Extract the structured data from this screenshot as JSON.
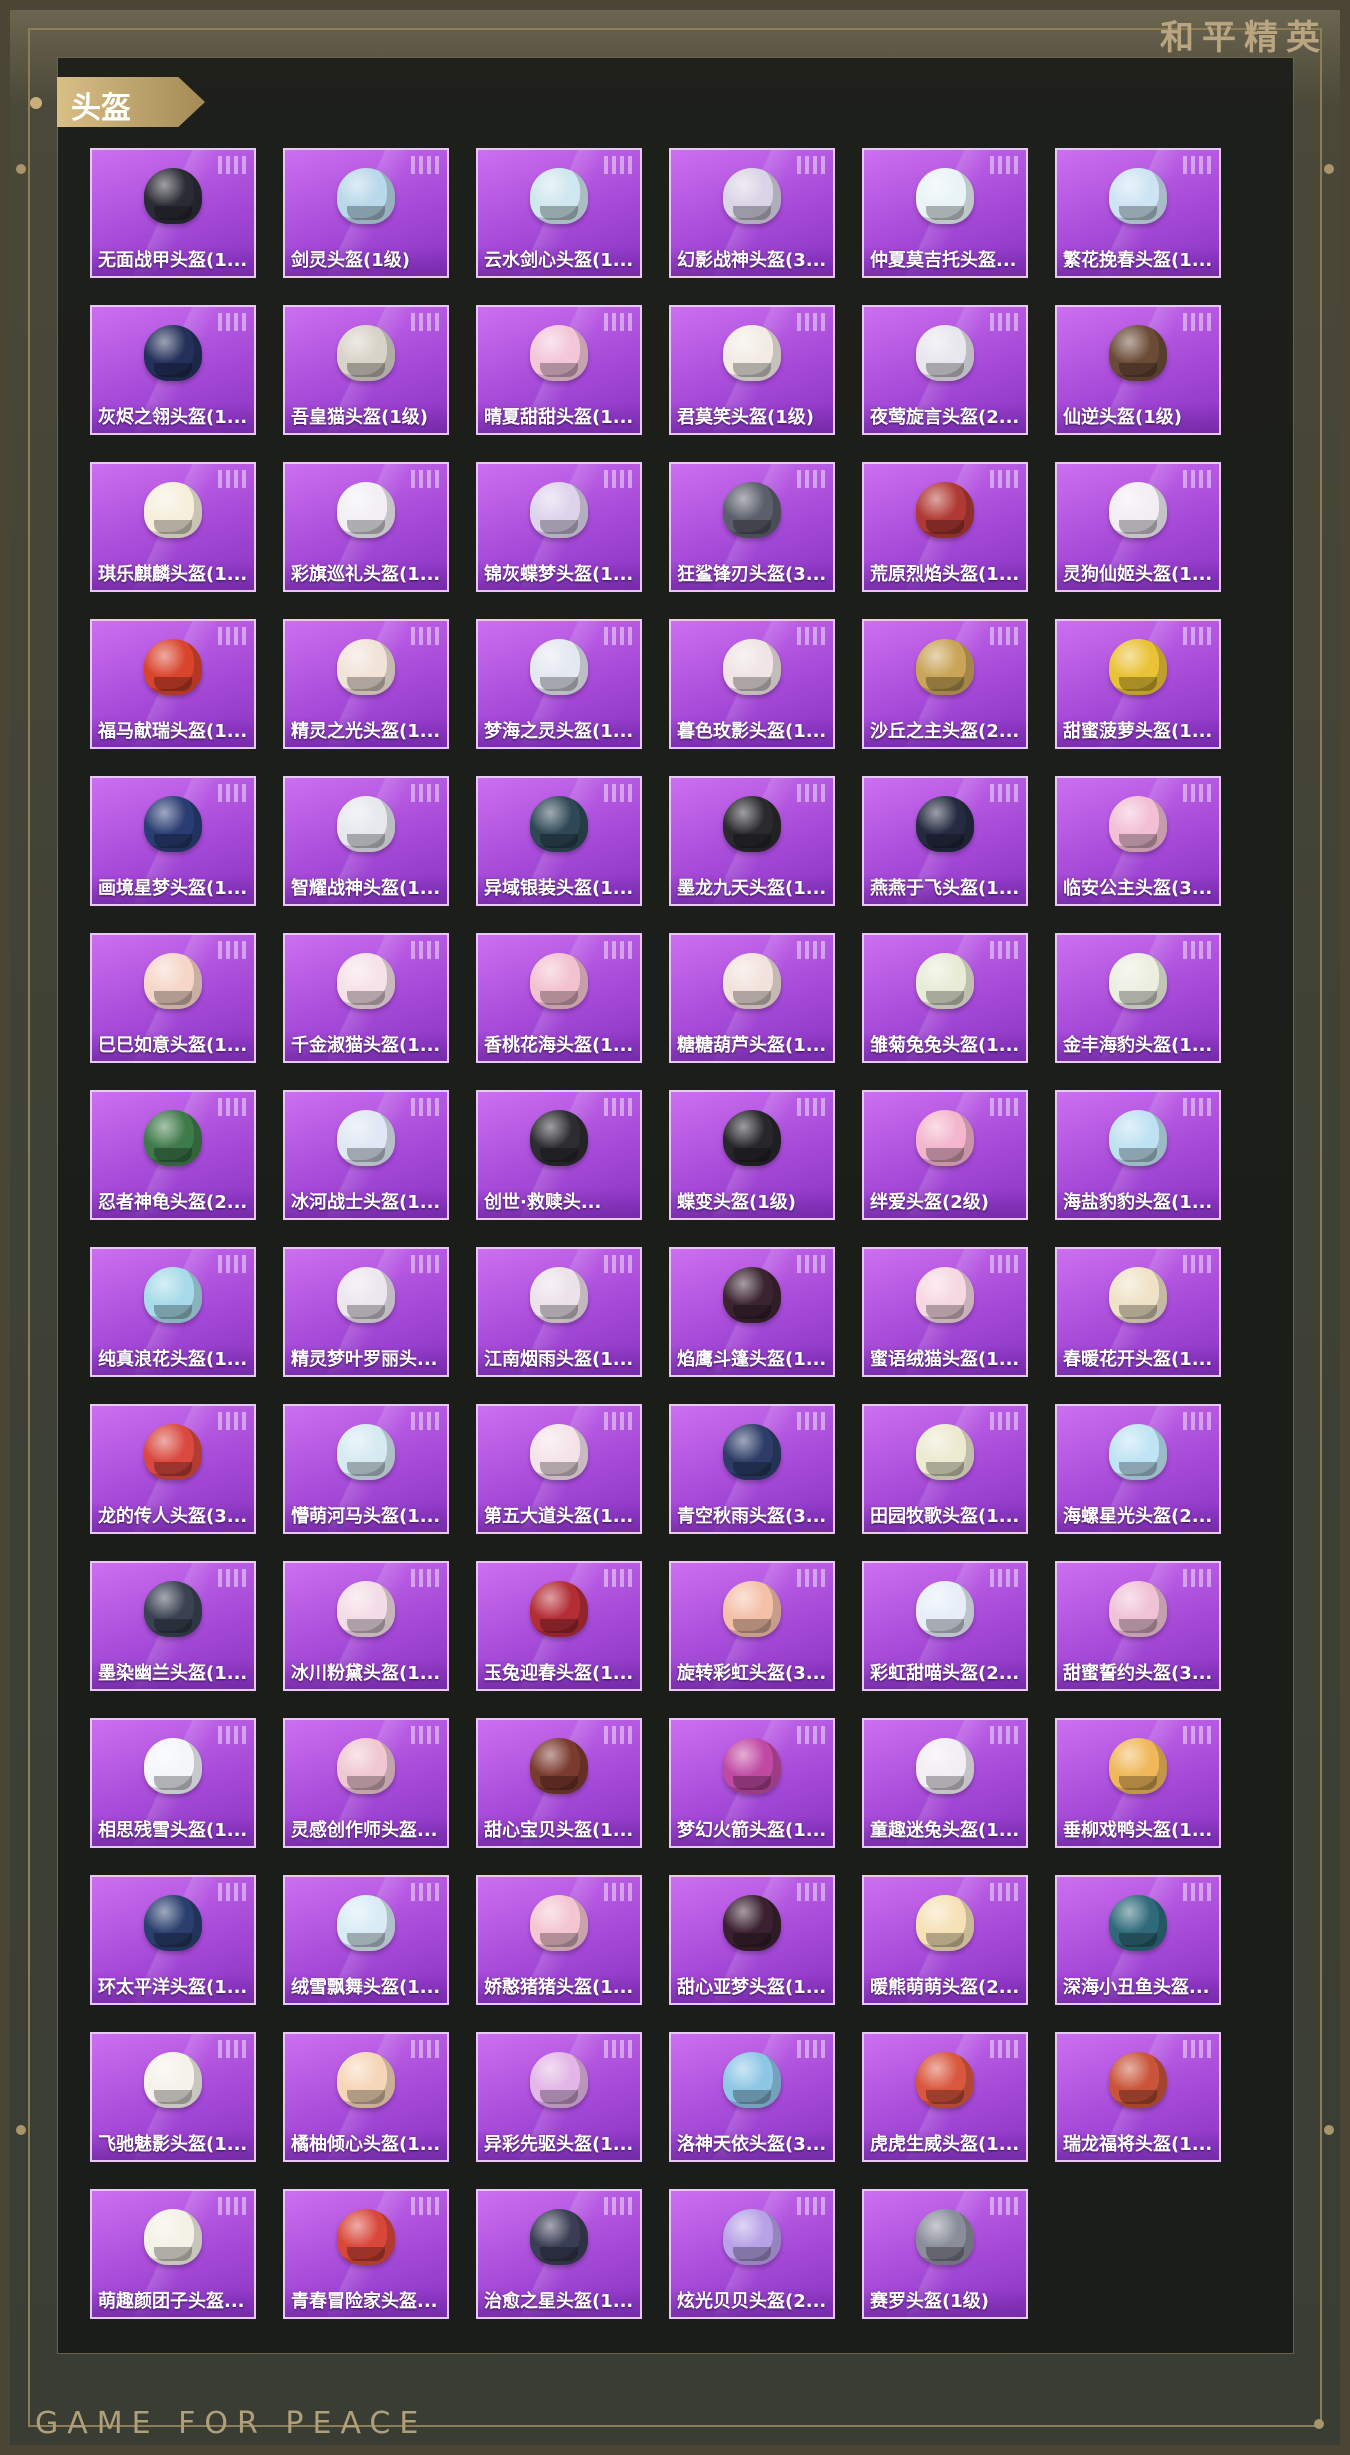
{
  "brand": "和平精英",
  "footer": "GAME FOR PEACE",
  "section_title": "头盔",
  "items": [
    {
      "label": "无面战甲头盔(1...",
      "color": "#2b2b35"
    },
    {
      "label": "剑灵头盔(1级)",
      "color": "#b9d8ea"
    },
    {
      "label": "云水剑心头盔(1...",
      "color": "#cfe7ee"
    },
    {
      "label": "幻影战神头盔(3...",
      "color": "#d9d4e6"
    },
    {
      "label": "仲夏莫吉托头盔...",
      "color": "#e9f4f6"
    },
    {
      "label": "繁花挽春头盔(1...",
      "color": "#cde4f3"
    },
    {
      "label": "灰烬之翎头盔(1...",
      "color": "#24305a"
    },
    {
      "label": "吾皇猫头盔(1级)",
      "color": "#d8d3c8"
    },
    {
      "label": "晴夏甜甜头盔(1...",
      "color": "#f3c6d8"
    },
    {
      "label": "君莫笑头盔(1级)",
      "color": "#f2ece4"
    },
    {
      "label": "夜莺旋言头盔(2...",
      "color": "#e8e6ee"
    },
    {
      "label": "仙逆头盔(1级)",
      "color": "#6b4b36"
    },
    {
      "label": "琪乐麒麟头盔(1...",
      "color": "#f6efdc"
    },
    {
      "label": "彩旗巡礼头盔(1...",
      "color": "#f2f0f4"
    },
    {
      "label": "锦灰蝶梦头盔(1...",
      "color": "#ddd4ec"
    },
    {
      "label": "狂鲨锋刃头盔(3...",
      "color": "#5b5f6b"
    },
    {
      "label": "荒原烈焰头盔(1...",
      "color": "#b03a33"
    },
    {
      "label": "灵狗仙姬头盔(1...",
      "color": "#f2eef4"
    },
    {
      "label": "福马献瑞头盔(1...",
      "color": "#d9442d"
    },
    {
      "label": "精灵之光头盔(1...",
      "color": "#f2e3d8"
    },
    {
      "label": "梦海之灵头盔(1...",
      "color": "#e4e8f0"
    },
    {
      "label": "暮色玫影头盔(1...",
      "color": "#f0e4e4"
    },
    {
      "label": "沙丘之主头盔(2...",
      "color": "#c9a557"
    },
    {
      "label": "甜蜜菠萝头盔(1...",
      "color": "#e9c235"
    },
    {
      "label": "画境星梦头盔(1...",
      "color": "#2a3d73"
    },
    {
      "label": "智耀战神头盔(1...",
      "color": "#e6e8ee"
    },
    {
      "label": "异域银装头盔(1...",
      "color": "#2e4855"
    },
    {
      "label": "墨龙九天头盔(1...",
      "color": "#2a2a2e"
    },
    {
      "label": "燕燕于飞头盔(1...",
      "color": "#242a40"
    },
    {
      "label": "临安公主头盔(3...",
      "color": "#f2bfd4"
    },
    {
      "label": "巳巳如意头盔(1...",
      "color": "#f6d6c8"
    },
    {
      "label": "千金淑猫头盔(1...",
      "color": "#f6e2e8"
    },
    {
      "label": "香桃花海头盔(1...",
      "color": "#f3c2d0"
    },
    {
      "label": "糖糖葫芦头盔(1...",
      "color": "#f2e2dc"
    },
    {
      "label": "雏菊兔兔头盔(1...",
      "color": "#e8ecd6"
    },
    {
      "label": "金丰海豹头盔(1...",
      "color": "#ecefe0"
    },
    {
      "label": "忍者神龟头盔(2...",
      "color": "#3f7a4a"
    },
    {
      "label": "冰河战士头盔(1...",
      "color": "#dfe8f4"
    },
    {
      "label": "创世·救赎头...",
      "color": "#2d2d31"
    },
    {
      "label": "蝶变头盔(1级)",
      "color": "#27272b"
    },
    {
      "label": "绊爱头盔(2级)",
      "color": "#f3b6cc"
    },
    {
      "label": "海盐豹豹头盔(1...",
      "color": "#bfe2f2"
    },
    {
      "label": "纯真浪花头盔(1...",
      "color": "#a7dbe9"
    },
    {
      "label": "精灵梦叶罗丽头...",
      "color": "#ece6ee"
    },
    {
      "label": "江南烟雨头盔(1...",
      "color": "#ece2ea"
    },
    {
      "label": "焰鹰斗篷头盔(1...",
      "color": "#3b2430"
    },
    {
      "label": "蜜语绒猫头盔(1...",
      "color": "#f6d8e2"
    },
    {
      "label": "春暖花开头盔(1...",
      "color": "#efe2c6"
    },
    {
      "label": "龙的传人头盔(3...",
      "color": "#d94940"
    },
    {
      "label": "懵萌河马头盔(1...",
      "color": "#d6eaf2"
    },
    {
      "label": "第五大道头盔(1...",
      "color": "#f4e4ea"
    },
    {
      "label": "青空秋雨头盔(3...",
      "color": "#2d3d68"
    },
    {
      "label": "田园牧歌头盔(1...",
      "color": "#ecead0"
    },
    {
      "label": "海螺星光头盔(2...",
      "color": "#bfe4f4"
    },
    {
      "label": "墨染幽兰头盔(1...",
      "color": "#3a4252"
    },
    {
      "label": "冰川粉黛头盔(1...",
      "color": "#f3dde6"
    },
    {
      "label": "玉兔迎春头盔(1...",
      "color": "#b32d35"
    },
    {
      "label": "旋转彩虹头盔(3...",
      "color": "#f4c0a8"
    },
    {
      "label": "彩虹甜喵头盔(2...",
      "color": "#e7eef8"
    },
    {
      "label": "甜蜜誓约头盔(3...",
      "color": "#f0c2d6"
    },
    {
      "label": "相思残雪头盔(1...",
      "color": "#f4f6fa"
    },
    {
      "label": "灵感创作师头盔...",
      "color": "#f0c8d2"
    },
    {
      "label": "甜心宝贝头盔(1...",
      "color": "#7a3a2e"
    },
    {
      "label": "梦幻火箭头盔(1...",
      "color": "#c04aa3"
    },
    {
      "label": "童趣迷兔头盔(1...",
      "color": "#f2eef4"
    },
    {
      "label": "垂柳戏鸭头盔(1...",
      "color": "#f0b85a"
    },
    {
      "label": "环太平洋头盔(1...",
      "color": "#2a3f6e"
    },
    {
      "label": "绒雪飘舞头盔(1...",
      "color": "#d9ecf6"
    },
    {
      "label": "娇憨猪猪头盔(1...",
      "color": "#f4c6d2"
    },
    {
      "label": "甜心亚梦头盔(1...",
      "color": "#3a2030"
    },
    {
      "label": "暖熊萌萌头盔(2...",
      "color": "#f6e2b6"
    },
    {
      "label": "深海小丑鱼头盔...",
      "color": "#2e6a7a"
    },
    {
      "label": "飞驰魅影头盔(1...",
      "color": "#f4f2ea"
    },
    {
      "label": "橘柚倾心头盔(1...",
      "color": "#f6d6b8"
    },
    {
      "label": "异彩先驱头盔(1...",
      "color": "#e2b6e6"
    },
    {
      "label": "洛神天依头盔(3...",
      "color": "#8ec6e6"
    },
    {
      "label": "虎虎生威头盔(1...",
      "color": "#d9573d"
    },
    {
      "label": "瑞龙福将头盔(1...",
      "color": "#c9543a"
    },
    {
      "label": "萌趣颜团子头盔...",
      "color": "#f2f2e6"
    },
    {
      "label": "青春冒险家头盔...",
      "color": "#d9473a"
    },
    {
      "label": "治愈之星头盔(1...",
      "color": "#3a3e54"
    },
    {
      "label": "炫光贝贝头盔(2...",
      "color": "#b7a2e8"
    },
    {
      "label": "赛罗头盔(1级)",
      "color": "#8a8e9a"
    }
  ]
}
